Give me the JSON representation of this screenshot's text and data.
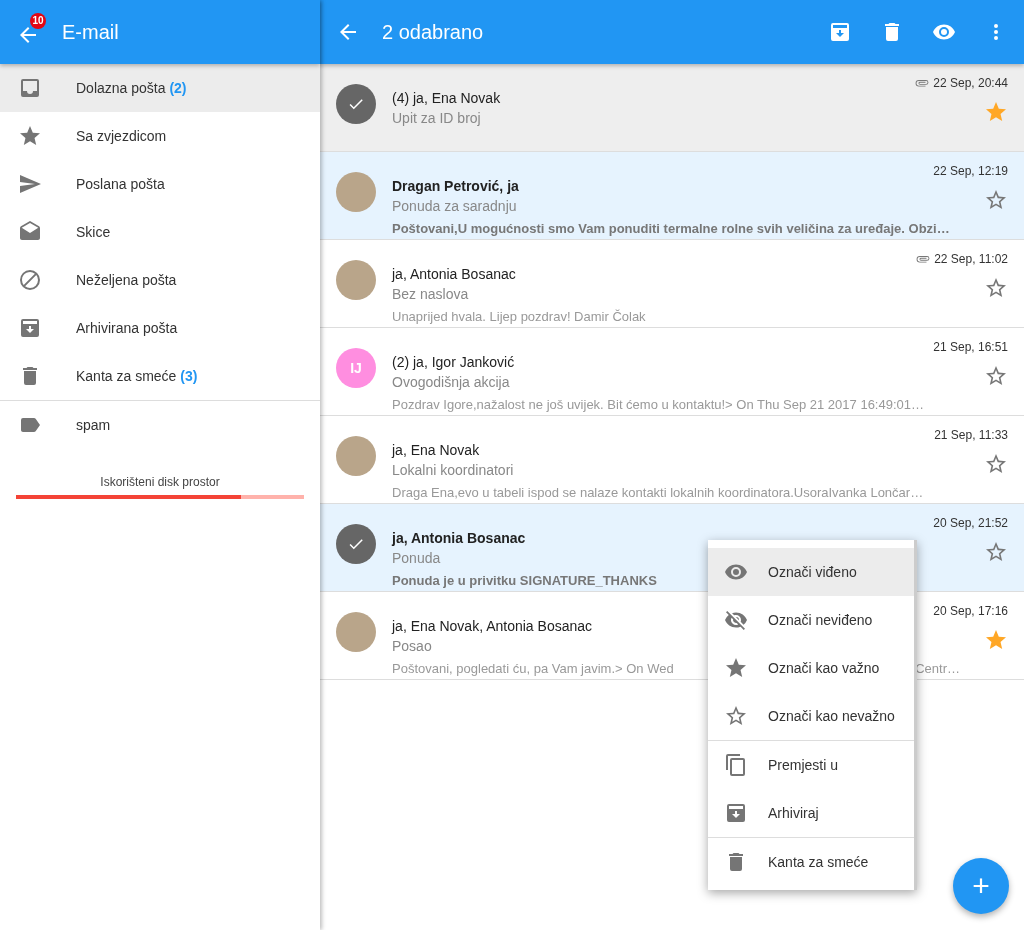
{
  "sidebar": {
    "title": "E-mail",
    "badge": "10",
    "items": [
      {
        "kind": "inbox",
        "label": "Dolazna pošta",
        "count": "(2)",
        "selected": true
      },
      {
        "kind": "star",
        "label": "Sa zvjezdicom",
        "selected": false
      },
      {
        "kind": "send",
        "label": "Poslana pošta",
        "selected": false
      },
      {
        "kind": "drafts",
        "label": "Skice",
        "selected": false
      },
      {
        "kind": "block",
        "label": "Neželjena pošta",
        "selected": false
      },
      {
        "kind": "archive",
        "label": "Arhivirana pošta",
        "selected": false
      },
      {
        "kind": "trash",
        "label": "Kanta za smeće",
        "count": "(3)",
        "selected": false
      }
    ],
    "labels": [
      {
        "kind": "label",
        "label": "spam",
        "selected": false
      }
    ],
    "disk": {
      "label": "Iskorišteni disk prostor",
      "level": 0.78
    }
  },
  "toolbar": {
    "title": "2 odabrano"
  },
  "messages": [
    {
      "from": "(4) ja, Ena Novak",
      "subject": "Upit za ID broj",
      "time": "22 Sep, 20:44",
      "attachment": true,
      "starred": true,
      "selected": true,
      "unread": false,
      "focused": true,
      "avatar": {
        "kind": "photo"
      }
    },
    {
      "from": "Dragan Petrović, ja",
      "subject": "Ponuda za saradnju",
      "preview": "Poštovani,U mogućnosti smo Vam ponuditi termalne rolne svih veličina za uređaje. Obzi…",
      "time": "22 Sep, 12:19",
      "attachment": false,
      "starred": false,
      "selected": false,
      "unread": true,
      "focused": false,
      "avatar": {
        "kind": "photo"
      }
    },
    {
      "from": "ja, Antonia Bosanac",
      "subject": "Bez naslova",
      "preview": "Unaprijed hvala. Lijep pozdrav! Damir Čolak",
      "time": "22 Sep, 11:02",
      "attachment": true,
      "starred": false,
      "selected": false,
      "unread": false,
      "focused": false,
      "avatar": {
        "kind": "photo"
      }
    },
    {
      "from": "(2) ja, Igor Janković",
      "subject": "Ovogodišnja akcija",
      "preview": "Pozdrav Igore,nažalost ne još uvijek. Bit ćemo u kontaktu!> On Thu Sep 21 2017 16:49:01…",
      "time": "21 Sep, 16:51",
      "attachment": false,
      "starred": false,
      "selected": false,
      "unread": false,
      "focused": false,
      "avatar": {
        "kind": "initials",
        "text": "IJ",
        "color": "#ff8ee0"
      }
    },
    {
      "from": "ja, Ena Novak",
      "subject": "Lokalni koordinatori",
      "preview": "Draga Ena,evo u tabeli ispod se nalaze kontakti lokalnih koordinatora.UsoraIvanka Lončar…",
      "time": "21 Sep, 11:33",
      "attachment": false,
      "starred": false,
      "selected": false,
      "unread": false,
      "focused": false,
      "avatar": {
        "kind": "photo"
      }
    },
    {
      "from": "ja, Antonia Bosanac",
      "subject": "Ponuda",
      "preview": "Ponuda je u privitku SIGNATURE_THANKS",
      "time": "20 Sep, 21:52",
      "attachment": false,
      "starred": false,
      "selected": true,
      "unread": true,
      "focused": false,
      "avatar": {
        "kind": "photo"
      }
    },
    {
      "from": "ja, Ena Novak, Antonia Bosanac",
      "subject": "Posao",
      "preview": "Poštovani, pogledati ću, pa Vam javim.> On Wed",
      "preview_tail": "Centr…",
      "time": "20 Sep, 17:16",
      "attachment": false,
      "starred": true,
      "selected": false,
      "unread": false,
      "focused": false,
      "avatar": {
        "kind": "photo"
      }
    }
  ],
  "menu": [
    {
      "kind": "eye",
      "label": "Označi viđeno",
      "selected": true
    },
    {
      "kind": "eye-off",
      "label": "Označi neviđeno",
      "selected": false
    },
    {
      "kind": "star",
      "label": "Označi kao važno",
      "selected": false
    },
    {
      "kind": "star-outline",
      "label": "Označi kao nevažno",
      "selected": false,
      "divider": true
    },
    {
      "kind": "copy",
      "label": "Premjesti u",
      "selected": false
    },
    {
      "kind": "archive",
      "label": "Arhiviraj",
      "selected": false,
      "divider": true
    },
    {
      "kind": "trash",
      "label": "Kanta za smeće",
      "selected": false
    }
  ],
  "fab": {
    "label": "+"
  }
}
